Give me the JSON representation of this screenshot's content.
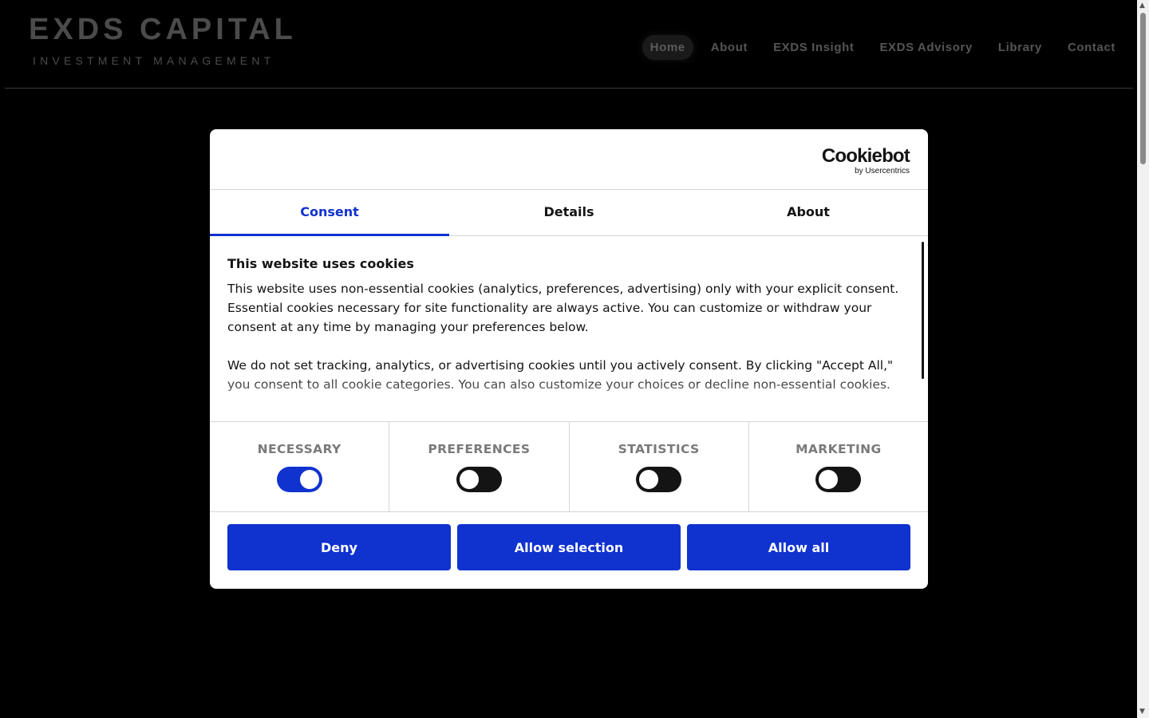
{
  "header": {
    "brand_title": "EXDS CAPITAL",
    "brand_subtitle": "INVESTMENT MANAGEMENT",
    "nav": [
      {
        "label": "Home",
        "active": true
      },
      {
        "label": "About"
      },
      {
        "label": "EXDS Insight"
      },
      {
        "label": "EXDS Advisory"
      },
      {
        "label": "Library"
      },
      {
        "label": "Contact"
      }
    ]
  },
  "dialog": {
    "logo_main": "Cookiebot",
    "logo_sub": "by Usercentrics",
    "tabs": [
      {
        "label": "Consent",
        "active": true
      },
      {
        "label": "Details"
      },
      {
        "label": "About"
      }
    ],
    "heading": "This website uses cookies",
    "paragraph1": "This website uses non-essential cookies (analytics, preferences, advertising) only with your explicit consent. Essential cookies necessary for site functionality are always active. You can customize or withdraw your consent at any time by managing your preferences below.",
    "paragraph2": "We do not set tracking, analytics, or advertising cookies until you actively consent. By clicking \"Accept All,\" you consent to all cookie categories. You can also customize your choices or decline non-essential cookies.",
    "categories": [
      {
        "label": "NECESSARY",
        "enabled": true
      },
      {
        "label": "PREFERENCES",
        "enabled": false
      },
      {
        "label": "STATISTICS",
        "enabled": false
      },
      {
        "label": "MARKETING",
        "enabled": false
      }
    ],
    "buttons": {
      "deny": "Deny",
      "allow_selection": "Allow selection",
      "allow_all": "Allow all"
    },
    "colors": {
      "accent": "#1032cf",
      "text": "#141414"
    }
  }
}
